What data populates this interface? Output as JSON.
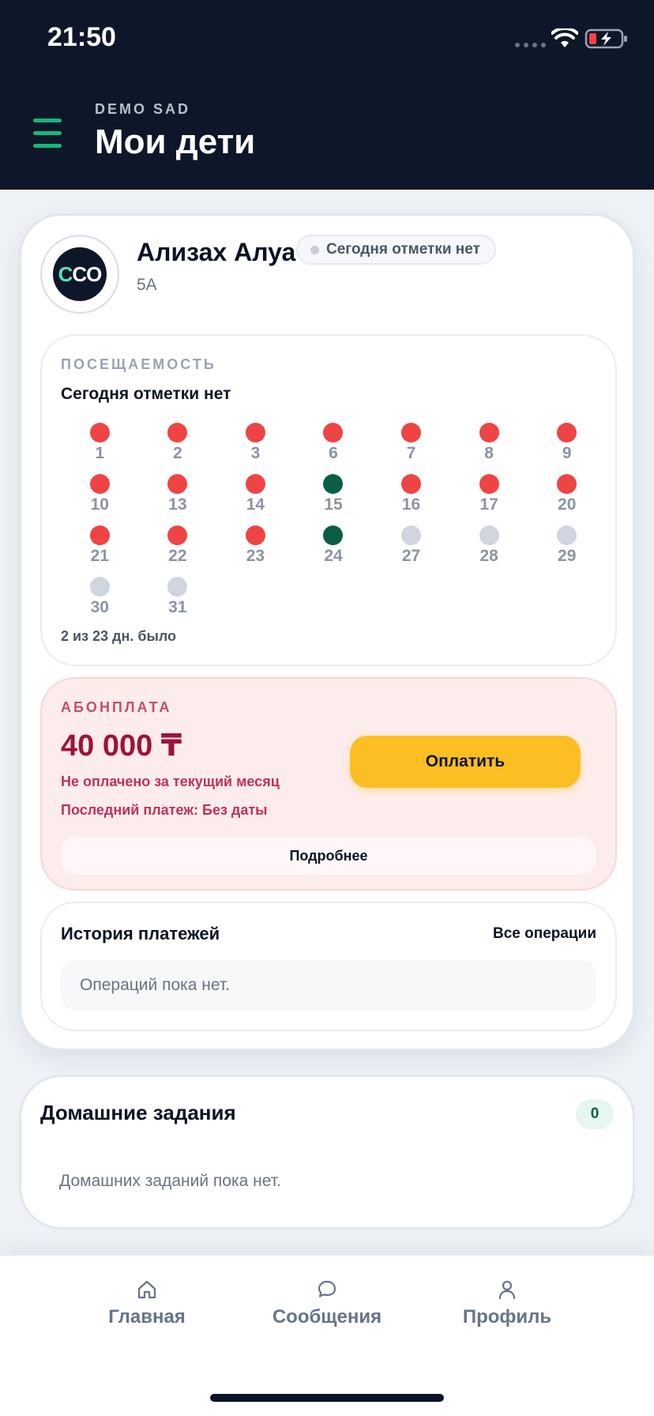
{
  "status_bar": {
    "time": "21:50"
  },
  "header": {
    "org_name": "DEMO SAD",
    "title": "Мои дети"
  },
  "child": {
    "avatar_text": [
      "C",
      "CO"
    ],
    "name": "Ализах Алуа",
    "status_badge": "Сегодня отметки нет",
    "class": "5А"
  },
  "attendance": {
    "label": "ПОСЕЩАЕМОСТЬ",
    "today": "Сегодня отметки нет",
    "days": [
      {
        "day": "1",
        "status": "absent"
      },
      {
        "day": "2",
        "status": "absent"
      },
      {
        "day": "3",
        "status": "absent"
      },
      {
        "day": "6",
        "status": "absent"
      },
      {
        "day": "7",
        "status": "absent"
      },
      {
        "day": "8",
        "status": "absent"
      },
      {
        "day": "9",
        "status": "absent"
      },
      {
        "day": "10",
        "status": "absent"
      },
      {
        "day": "13",
        "status": "absent"
      },
      {
        "day": "14",
        "status": "absent"
      },
      {
        "day": "15",
        "status": "present"
      },
      {
        "day": "16",
        "status": "absent"
      },
      {
        "day": "17",
        "status": "absent"
      },
      {
        "day": "20",
        "status": "absent"
      },
      {
        "day": "21",
        "status": "absent"
      },
      {
        "day": "22",
        "status": "absent"
      },
      {
        "day": "23",
        "status": "absent"
      },
      {
        "day": "24",
        "status": "present"
      },
      {
        "day": "27",
        "status": "future"
      },
      {
        "day": "28",
        "status": "future"
      },
      {
        "day": "29",
        "status": "future"
      },
      {
        "day": "30",
        "status": "future"
      },
      {
        "day": "31",
        "status": "future"
      }
    ],
    "summary": "2 из 23 дн. было",
    "colors": {
      "absent": "#ef4444",
      "present": "#0b5e44",
      "future": "#cfd6e0"
    }
  },
  "fee": {
    "label": "АБОНПЛАТА",
    "amount": "40 000 ₸",
    "status": "Не оплачено за текущий месяц",
    "last_payment": "Последний платеж: Без даты",
    "pay_button": "Оплатить",
    "details_button": "Подробнее"
  },
  "payment_history": {
    "title": "История платежей",
    "all_link": "Все операции",
    "empty_text": "Операций пока нет."
  },
  "homework": {
    "title": "Домашние задания",
    "count": "0",
    "empty_text": "Домашних заданий пока нет."
  },
  "tabbar": {
    "items": [
      {
        "label": "Главная",
        "icon": "home-icon"
      },
      {
        "label": "Сообщения",
        "icon": "message-icon"
      },
      {
        "label": "Профиль",
        "icon": "profile-icon"
      }
    ]
  }
}
